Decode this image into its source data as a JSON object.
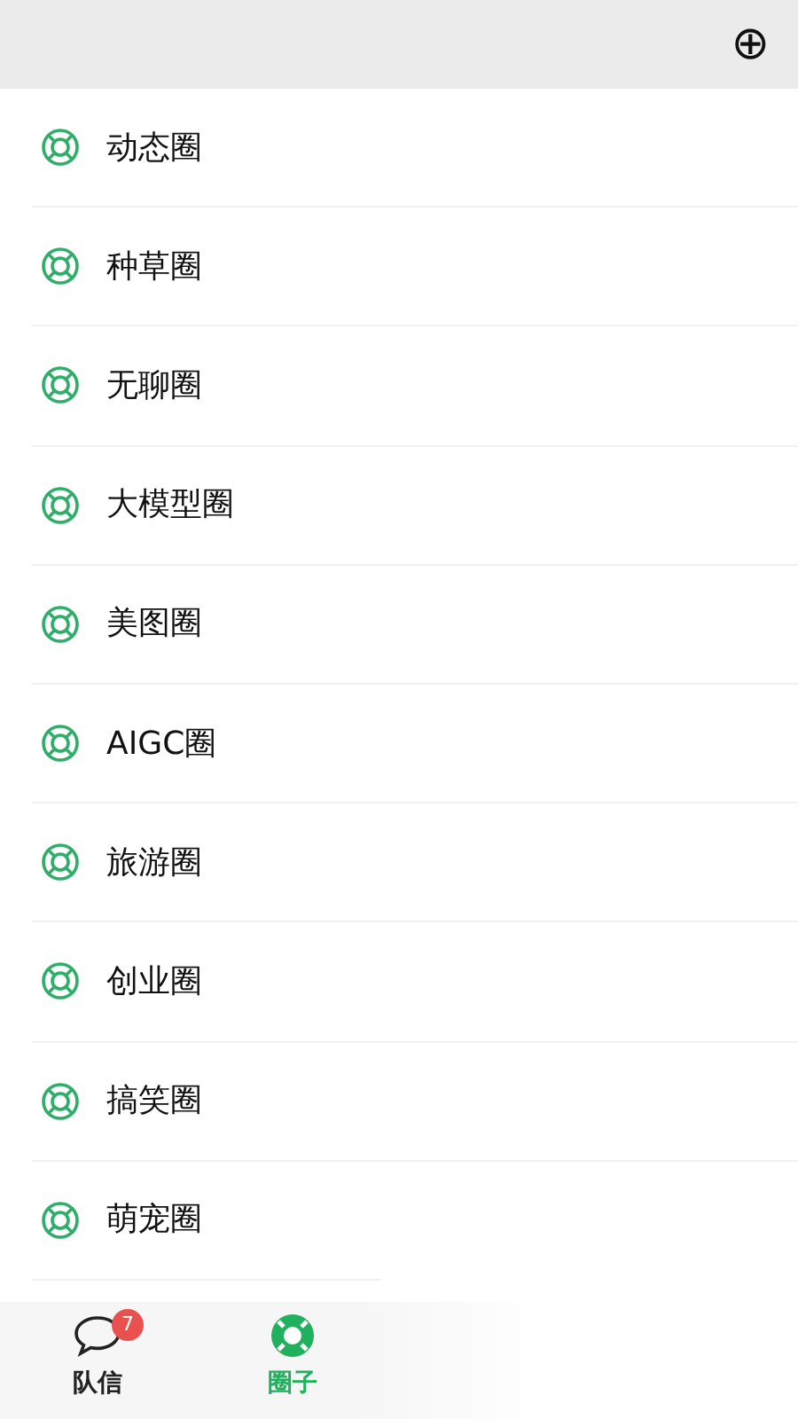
{
  "header": {
    "action": "⊕"
  },
  "circles": [
    {
      "name": "动态圈"
    },
    {
      "name": "种草圈"
    },
    {
      "name": "无聊圈"
    },
    {
      "name": "大模型圈"
    },
    {
      "name": "美图圈"
    },
    {
      "name": "AIGC圈"
    },
    {
      "name": "旅游圈"
    },
    {
      "name": "创业圈"
    },
    {
      "name": "搞笑圈"
    },
    {
      "name": "萌宠圈"
    }
  ],
  "tabs": [
    {
      "kind": "chat",
      "label": "队信",
      "badge": "7",
      "selected": false
    },
    {
      "kind": "circle",
      "label": "圈子",
      "selected": true
    }
  ]
}
